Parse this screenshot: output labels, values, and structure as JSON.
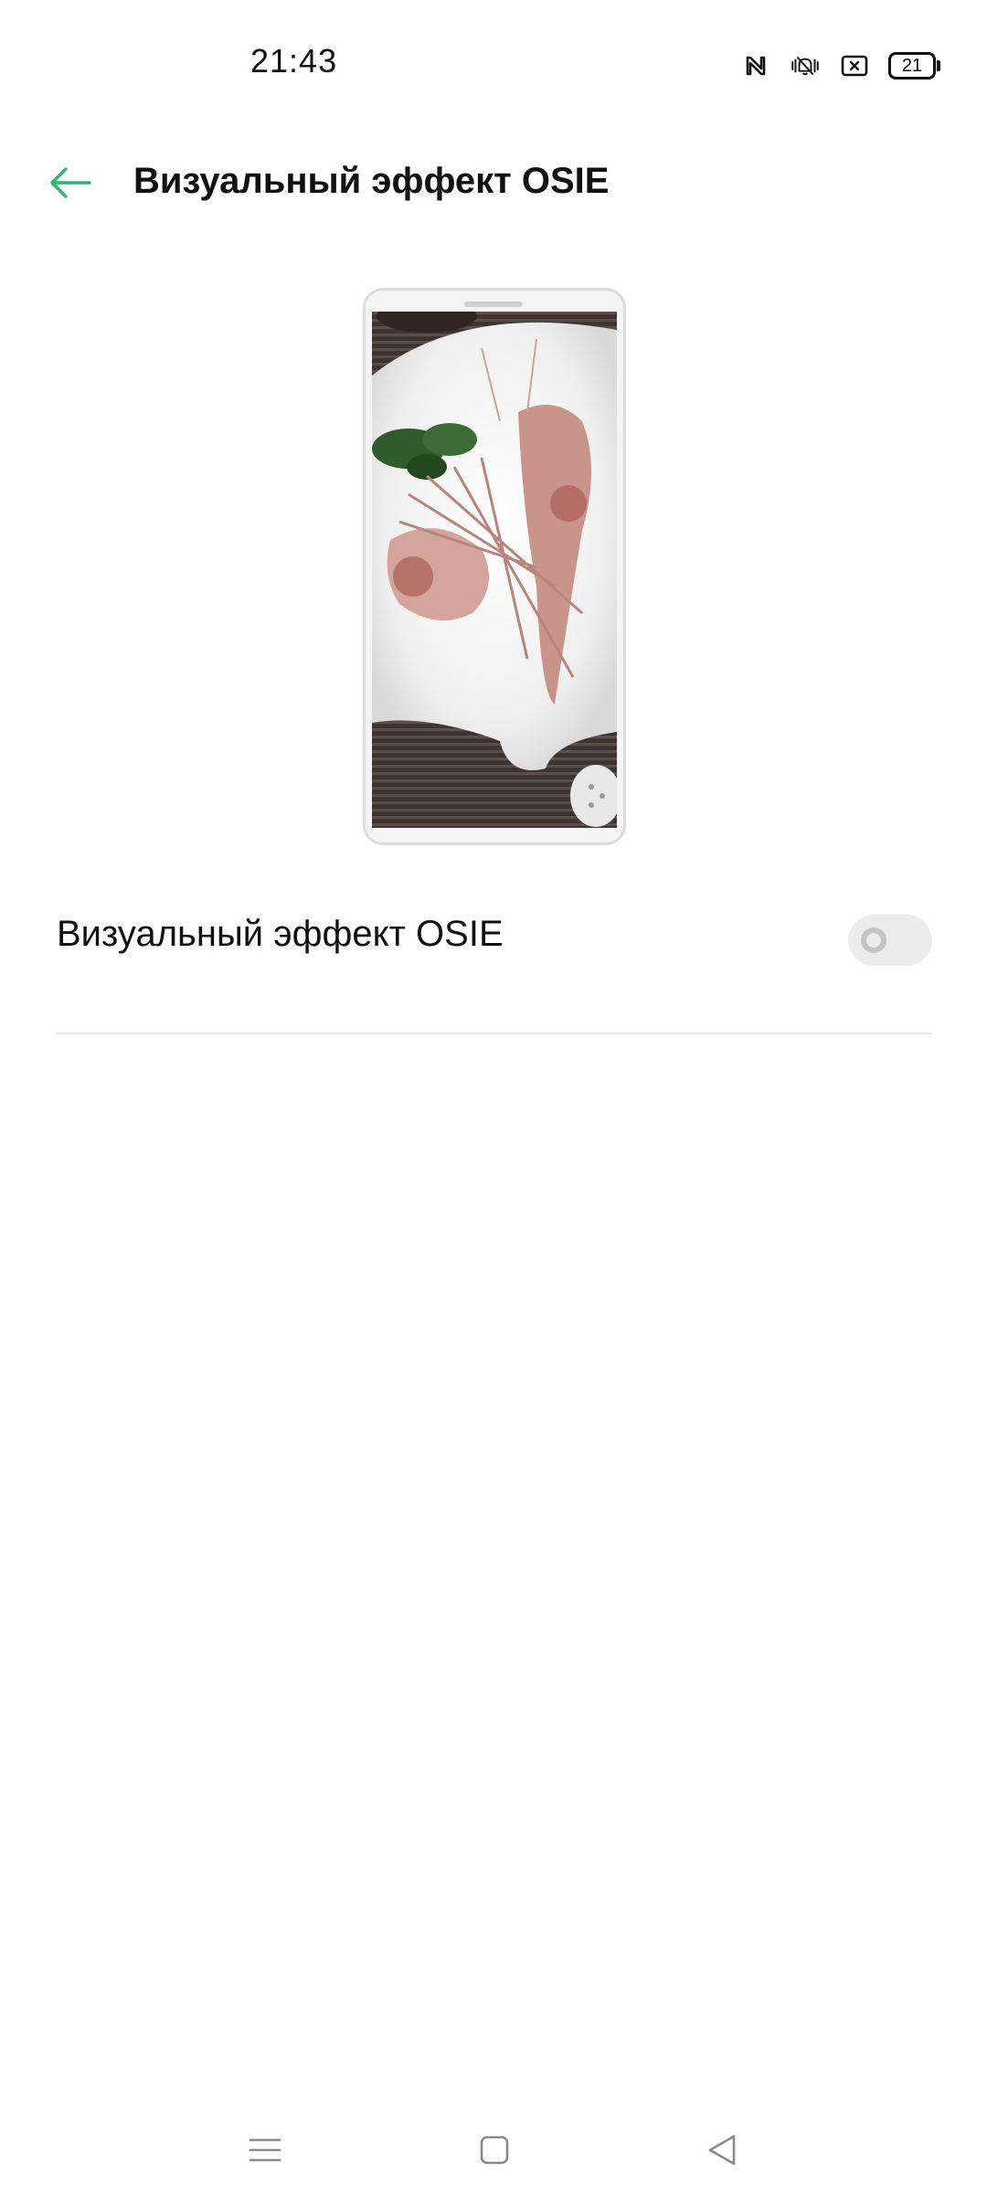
{
  "status_bar": {
    "time": "21:43",
    "icons": [
      "nfc-icon",
      "vibrate-icon",
      "muted-bell-icon",
      "screen-cast-icon",
      "battery-icon"
    ],
    "battery_level": "21"
  },
  "header": {
    "back_icon": "arrow-left-icon",
    "title": "Визуальный эффект OSIE"
  },
  "preview": {
    "description_icon": "phone-preview"
  },
  "settings": {
    "osie_label": "Визуальный эффект OSIE",
    "osie_enabled": false
  },
  "nav_bar": {
    "menu_icon": "menu-icon",
    "home_icon": "home-icon",
    "back_icon": "back-triangle-icon"
  },
  "colors": {
    "accent": "#2bb673",
    "text": "#111111",
    "toggle_off": "#ececec",
    "divider": "#e6e6e6"
  }
}
